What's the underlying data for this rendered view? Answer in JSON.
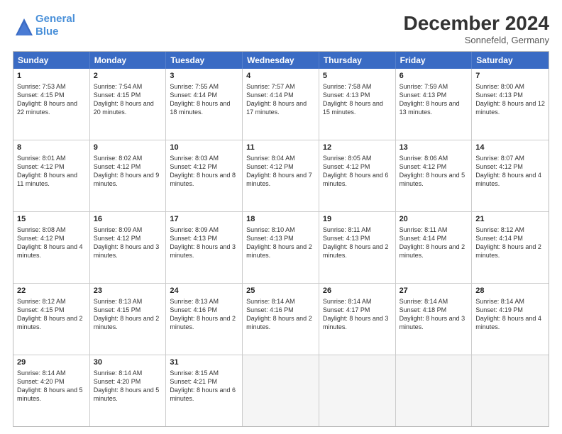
{
  "logo": {
    "line1": "General",
    "line2": "Blue"
  },
  "title": "December 2024",
  "subtitle": "Sonnefeld, Germany",
  "days_of_week": [
    "Sunday",
    "Monday",
    "Tuesday",
    "Wednesday",
    "Thursday",
    "Friday",
    "Saturday"
  ],
  "weeks": [
    [
      {
        "day": 1,
        "sunrise": "Sunrise: 7:53 AM",
        "sunset": "Sunset: 4:15 PM",
        "daylight": "Daylight: 8 hours and 22 minutes."
      },
      {
        "day": 2,
        "sunrise": "Sunrise: 7:54 AM",
        "sunset": "Sunset: 4:15 PM",
        "daylight": "Daylight: 8 hours and 20 minutes."
      },
      {
        "day": 3,
        "sunrise": "Sunrise: 7:55 AM",
        "sunset": "Sunset: 4:14 PM",
        "daylight": "Daylight: 8 hours and 18 minutes."
      },
      {
        "day": 4,
        "sunrise": "Sunrise: 7:57 AM",
        "sunset": "Sunset: 4:14 PM",
        "daylight": "Daylight: 8 hours and 17 minutes."
      },
      {
        "day": 5,
        "sunrise": "Sunrise: 7:58 AM",
        "sunset": "Sunset: 4:13 PM",
        "daylight": "Daylight: 8 hours and 15 minutes."
      },
      {
        "day": 6,
        "sunrise": "Sunrise: 7:59 AM",
        "sunset": "Sunset: 4:13 PM",
        "daylight": "Daylight: 8 hours and 13 minutes."
      },
      {
        "day": 7,
        "sunrise": "Sunrise: 8:00 AM",
        "sunset": "Sunset: 4:13 PM",
        "daylight": "Daylight: 8 hours and 12 minutes."
      }
    ],
    [
      {
        "day": 8,
        "sunrise": "Sunrise: 8:01 AM",
        "sunset": "Sunset: 4:12 PM",
        "daylight": "Daylight: 8 hours and 11 minutes."
      },
      {
        "day": 9,
        "sunrise": "Sunrise: 8:02 AM",
        "sunset": "Sunset: 4:12 PM",
        "daylight": "Daylight: 8 hours and 9 minutes."
      },
      {
        "day": 10,
        "sunrise": "Sunrise: 8:03 AM",
        "sunset": "Sunset: 4:12 PM",
        "daylight": "Daylight: 8 hours and 8 minutes."
      },
      {
        "day": 11,
        "sunrise": "Sunrise: 8:04 AM",
        "sunset": "Sunset: 4:12 PM",
        "daylight": "Daylight: 8 hours and 7 minutes."
      },
      {
        "day": 12,
        "sunrise": "Sunrise: 8:05 AM",
        "sunset": "Sunset: 4:12 PM",
        "daylight": "Daylight: 8 hours and 6 minutes."
      },
      {
        "day": 13,
        "sunrise": "Sunrise: 8:06 AM",
        "sunset": "Sunset: 4:12 PM",
        "daylight": "Daylight: 8 hours and 5 minutes."
      },
      {
        "day": 14,
        "sunrise": "Sunrise: 8:07 AM",
        "sunset": "Sunset: 4:12 PM",
        "daylight": "Daylight: 8 hours and 4 minutes."
      }
    ],
    [
      {
        "day": 15,
        "sunrise": "Sunrise: 8:08 AM",
        "sunset": "Sunset: 4:12 PM",
        "daylight": "Daylight: 8 hours and 4 minutes."
      },
      {
        "day": 16,
        "sunrise": "Sunrise: 8:09 AM",
        "sunset": "Sunset: 4:12 PM",
        "daylight": "Daylight: 8 hours and 3 minutes."
      },
      {
        "day": 17,
        "sunrise": "Sunrise: 8:09 AM",
        "sunset": "Sunset: 4:13 PM",
        "daylight": "Daylight: 8 hours and 3 minutes."
      },
      {
        "day": 18,
        "sunrise": "Sunrise: 8:10 AM",
        "sunset": "Sunset: 4:13 PM",
        "daylight": "Daylight: 8 hours and 2 minutes."
      },
      {
        "day": 19,
        "sunrise": "Sunrise: 8:11 AM",
        "sunset": "Sunset: 4:13 PM",
        "daylight": "Daylight: 8 hours and 2 minutes."
      },
      {
        "day": 20,
        "sunrise": "Sunrise: 8:11 AM",
        "sunset": "Sunset: 4:14 PM",
        "daylight": "Daylight: 8 hours and 2 minutes."
      },
      {
        "day": 21,
        "sunrise": "Sunrise: 8:12 AM",
        "sunset": "Sunset: 4:14 PM",
        "daylight": "Daylight: 8 hours and 2 minutes."
      }
    ],
    [
      {
        "day": 22,
        "sunrise": "Sunrise: 8:12 AM",
        "sunset": "Sunset: 4:15 PM",
        "daylight": "Daylight: 8 hours and 2 minutes."
      },
      {
        "day": 23,
        "sunrise": "Sunrise: 8:13 AM",
        "sunset": "Sunset: 4:15 PM",
        "daylight": "Daylight: 8 hours and 2 minutes."
      },
      {
        "day": 24,
        "sunrise": "Sunrise: 8:13 AM",
        "sunset": "Sunset: 4:16 PM",
        "daylight": "Daylight: 8 hours and 2 minutes."
      },
      {
        "day": 25,
        "sunrise": "Sunrise: 8:14 AM",
        "sunset": "Sunset: 4:16 PM",
        "daylight": "Daylight: 8 hours and 2 minutes."
      },
      {
        "day": 26,
        "sunrise": "Sunrise: 8:14 AM",
        "sunset": "Sunset: 4:17 PM",
        "daylight": "Daylight: 8 hours and 3 minutes."
      },
      {
        "day": 27,
        "sunrise": "Sunrise: 8:14 AM",
        "sunset": "Sunset: 4:18 PM",
        "daylight": "Daylight: 8 hours and 3 minutes."
      },
      {
        "day": 28,
        "sunrise": "Sunrise: 8:14 AM",
        "sunset": "Sunset: 4:19 PM",
        "daylight": "Daylight: 8 hours and 4 minutes."
      }
    ],
    [
      {
        "day": 29,
        "sunrise": "Sunrise: 8:14 AM",
        "sunset": "Sunset: 4:20 PM",
        "daylight": "Daylight: 8 hours and 5 minutes."
      },
      {
        "day": 30,
        "sunrise": "Sunrise: 8:14 AM",
        "sunset": "Sunset: 4:20 PM",
        "daylight": "Daylight: 8 hours and 5 minutes."
      },
      {
        "day": 31,
        "sunrise": "Sunrise: 8:15 AM",
        "sunset": "Sunset: 4:21 PM",
        "daylight": "Daylight: 8 hours and 6 minutes."
      },
      null,
      null,
      null,
      null
    ]
  ]
}
